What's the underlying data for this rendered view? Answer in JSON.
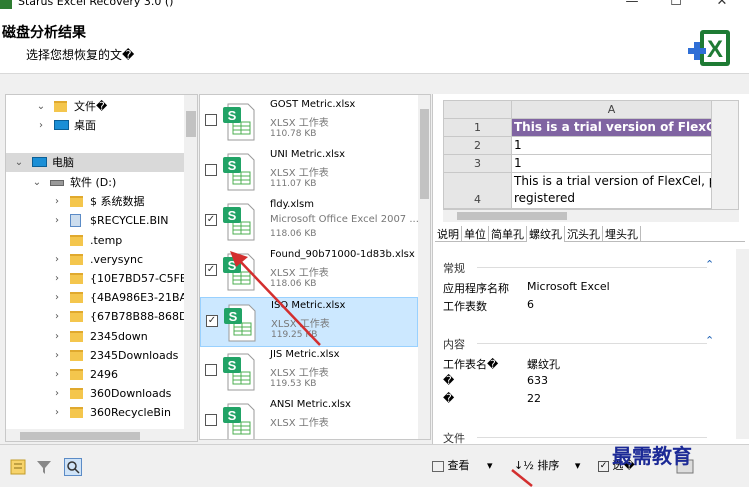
{
  "window": {
    "title": "Starus Excel Recovery 3.0 ()",
    "controls": [
      "—",
      "☐",
      "✕"
    ]
  },
  "header": {
    "title": "磁盘分析结果",
    "subtitle": "选择您想恢复的文�"
  },
  "tree": {
    "items": [
      {
        "label": "文件�",
        "chev": "⌄",
        "icon": "folder-icon"
      },
      {
        "label": "桌面",
        "chev": "›",
        "icon": "desktop-icon"
      },
      {
        "label": "电脑",
        "chev": "⌄",
        "icon": "computer-icon"
      },
      {
        "label": "软件 (D:)",
        "chev": "⌄",
        "icon": "drive-icon"
      },
      {
        "label": "$ 系统数据",
        "chev": "›",
        "icon": "folder-icon"
      },
      {
        "label": "$RECYCLE.BIN",
        "chev": "›",
        "icon": "recycle-icon"
      },
      {
        "label": ".temp",
        "chev": "",
        "icon": "folder-icon"
      },
      {
        "label": ".verysync",
        "chev": "›",
        "icon": "folder-icon"
      },
      {
        "label": "{10E7BD57-C5FE-",
        "chev": "›",
        "icon": "folder-icon"
      },
      {
        "label": "{4BA986E3-21BA-",
        "chev": "›",
        "icon": "folder-icon"
      },
      {
        "label": "{67B78B88-868D-",
        "chev": "›",
        "icon": "folder-icon"
      },
      {
        "label": "2345down",
        "chev": "›",
        "icon": "folder-icon"
      },
      {
        "label": "2345Downloads",
        "chev": "›",
        "icon": "folder-icon"
      },
      {
        "label": "2496",
        "chev": "›",
        "icon": "folder-icon"
      },
      {
        "label": "360Downloads",
        "chev": "›",
        "icon": "folder-icon"
      },
      {
        "label": "360RecycleBin",
        "chev": "›",
        "icon": "folder-icon"
      }
    ]
  },
  "files": [
    {
      "name": "GOST Metric.xlsx",
      "type": "XLSX 工作表",
      "size": "110.78 KB",
      "checked": false
    },
    {
      "name": "UNI Metric.xlsx",
      "type": "XLSX 工作表",
      "size": "111.07 KB",
      "checked": false
    },
    {
      "name": "fldy.xlsm",
      "type": "Microsoft Office Excel 2007 ...",
      "size": "118.06 KB",
      "checked": true
    },
    {
      "name": "Found_90b71000-1d83b.xlsx",
      "type": "XLSX 工作表",
      "size": "118.06 KB",
      "checked": true
    },
    {
      "name": "ISO Metric.xlsx",
      "type": "XLSX 工作表",
      "size": "119.25 KB",
      "checked": true,
      "selected": true
    },
    {
      "name": "JIS Metric.xlsx",
      "type": "XLSX 工作表",
      "size": "119.53 KB",
      "checked": false
    },
    {
      "name": "ANSI Metric.xlsx",
      "type": "XLSX 工作表",
      "size": "",
      "checked": false
    }
  ],
  "preview": {
    "col_header": "A",
    "rows": [
      {
        "num": "1",
        "text": "This is a trial version of FlexCel, p",
        "trial": true
      },
      {
        "num": "2",
        "text": "1",
        "trial": false
      },
      {
        "num": "3",
        "text": "1",
        "trial": false
      },
      {
        "num": "4",
        "text": "This is a trial version of FlexCel, p",
        "text2": "registered",
        "trial": false
      }
    ],
    "tabs": [
      "说明",
      "单位",
      "简单孔",
      "螺纹孔",
      "沉头孔",
      "埋头孔"
    ]
  },
  "props": {
    "general_title": "常规",
    "general": [
      {
        "label": "应用程序名称",
        "value": "Microsoft Excel"
      },
      {
        "label": "工作表数",
        "value": "6"
      }
    ],
    "content_title": "内容",
    "content": [
      {
        "label": "工作表名�",
        "value": "螺纹孔"
      },
      {
        "label": "�",
        "value": "633"
      },
      {
        "label": "�",
        "value": "22"
      }
    ],
    "file_title": "文件"
  },
  "toolbar": {
    "view_label": "查看",
    "sort_label": "排序",
    "select_label": "选�",
    "watermark": "最需教育"
  },
  "colors": {
    "selection": "#cce8ff",
    "trial_fill": "#8064a2",
    "accent": "#1a5fb4",
    "arrow": "#d32f2f"
  }
}
